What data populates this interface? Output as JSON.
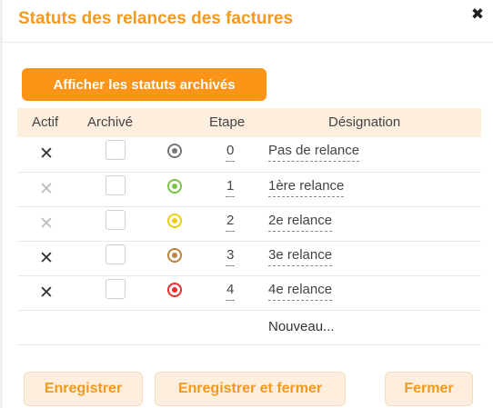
{
  "dialog": {
    "title": "Statuts des relances des factures",
    "close_glyph": "✖",
    "show_archived_label": "Afficher les statuts archivés"
  },
  "table": {
    "headers": {
      "active": "Actif",
      "archived": "Archivé",
      "step": "Etape",
      "designation": "Désignation"
    },
    "rows": [
      {
        "active_mark": "✕",
        "active": true,
        "archived": false,
        "status_color": "#777777",
        "step": "0",
        "designation": "Pas de relance"
      },
      {
        "active_mark": "✕",
        "active": false,
        "archived": false,
        "status_color": "#7cc242",
        "step": "1",
        "designation": "1ère relance"
      },
      {
        "active_mark": "✕",
        "active": false,
        "archived": false,
        "status_color": "#e8cf1d",
        "step": "2",
        "designation": "2e relance"
      },
      {
        "active_mark": "✕",
        "active": true,
        "archived": false,
        "status_color": "#b8843d",
        "step": "3",
        "designation": "3e relance"
      },
      {
        "active_mark": "✕",
        "active": true,
        "archived": false,
        "status_color": "#e32f2f",
        "step": "4",
        "designation": "4e relance"
      }
    ],
    "new_label": "Nouveau..."
  },
  "footer": {
    "save_label": "Enregistrer",
    "save_close_label": "Enregistrer et fermer",
    "close_label": "Fermer"
  },
  "colors": {
    "accent": "#f39a1e",
    "active_mark": "#333333",
    "inactive_mark": "#bdbdbd"
  }
}
